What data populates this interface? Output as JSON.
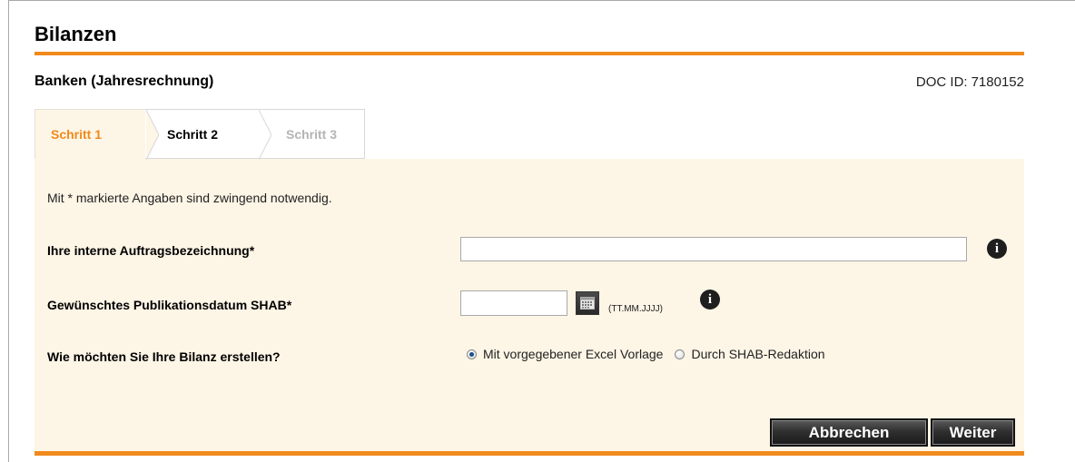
{
  "page": {
    "title": "Bilanzen",
    "subtitle": "Banken (Jahresrechnung)",
    "doc_id_label": "DOC ID:",
    "doc_id_value": "7180152"
  },
  "steps": [
    {
      "label": "Schritt 1",
      "state": "active"
    },
    {
      "label": "Schritt 2",
      "state": "enabled"
    },
    {
      "label": "Schritt 3",
      "state": "disabled"
    }
  ],
  "form": {
    "required_note": "Mit * markierte Angaben sind zwingend notwendig.",
    "order_label": "Ihre interne Auftragsbezeichnung*",
    "order_value": "",
    "date_label": "Gewünschtes Publikationsdatum SHAB*",
    "date_value": "",
    "date_format_hint": "(TT.MM.JJJJ)",
    "creation_label": "Wie möchten Sie Ihre Bilanz erstellen?",
    "creation_options": [
      {
        "label": "Mit vorgegebener Excel Vorlage",
        "checked": true
      },
      {
        "label": "Durch SHAB-Redaktion",
        "checked": false
      }
    ]
  },
  "buttons": {
    "cancel": "Abbrechen",
    "next": "Weiter"
  },
  "icons": {
    "info": "info-icon",
    "calendar": "calendar-icon"
  },
  "colors": {
    "accent": "#f08a1c",
    "panel_background": "#fdf5e6",
    "disabled_text": "#b4b4b4"
  }
}
